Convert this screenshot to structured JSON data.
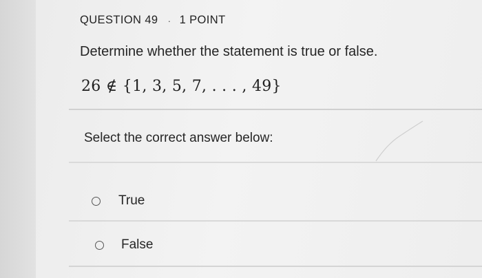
{
  "question": {
    "number_label": "QUESTION 49",
    "separator": "·",
    "points_label": "1 POINT",
    "prompt": "Determine whether the statement is true or false.",
    "statement": "26 ∉ {1, 3, 5, 7, . . . , 49}"
  },
  "answer": {
    "instruction": "Select the correct answer below:",
    "options": [
      {
        "label": "True",
        "selected": false
      },
      {
        "label": "False",
        "selected": false
      }
    ]
  },
  "colors": {
    "text": "#262626",
    "divider": "#d0d0d0",
    "radio_border": "#555555",
    "background": "#f1f1f1"
  },
  "icons": {
    "option_marker": "radio-button-empty"
  }
}
